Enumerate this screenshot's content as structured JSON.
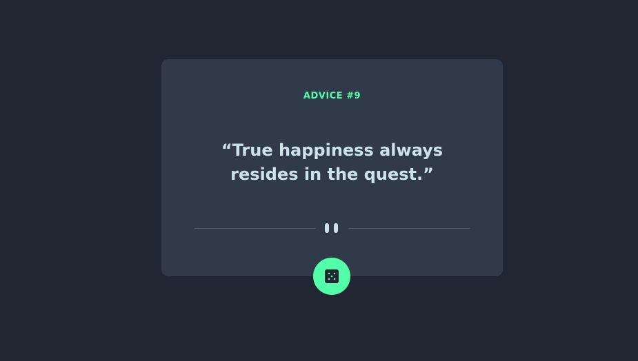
{
  "advice": {
    "id_label": "ADVICE #9",
    "quote": "“True happiness always resides in the quest.”"
  },
  "colors": {
    "background": "#202632",
    "card": "#313a49",
    "accent": "#52ffa8",
    "text": "#cee3e9",
    "divider": "#4f5d74"
  },
  "icons": {
    "divider": "pause-icon",
    "button": "dice-icon"
  }
}
